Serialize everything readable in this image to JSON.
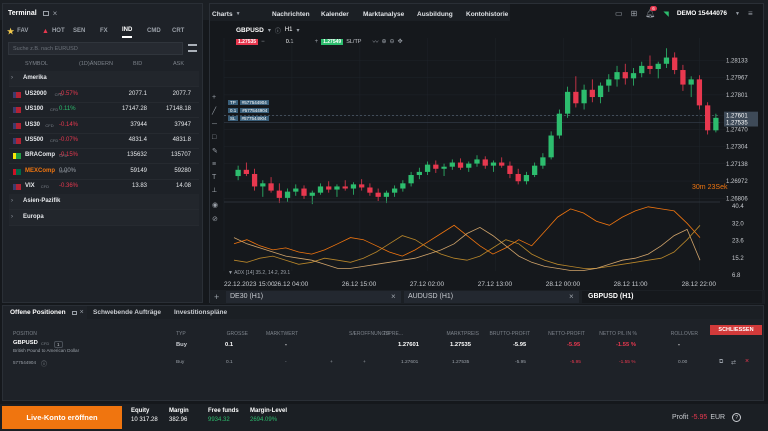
{
  "topbar": {
    "terminal": "Terminal",
    "charts": "Charts",
    "nav": [
      "Nachrichten",
      "Kalender",
      "Marktanalyse",
      "Ausbildung",
      "Kontohistorie"
    ],
    "account": "DEMO 15444076",
    "badge": "6"
  },
  "market": {
    "tabs": [
      "FAV",
      "HOT",
      "SEN",
      "FX",
      "IND",
      "CMD",
      "CRT"
    ],
    "search_placeholder": "Suche z.B. nach EURUSD",
    "columns": [
      "SYMBOL",
      "(1D)ÄNDERN",
      "BID",
      "ASK"
    ],
    "group_america": "Amerika",
    "rows": [
      {
        "symbol": "US2000",
        "tag": "CFD",
        "change": "-0.57%",
        "bid": "2077.1",
        "ask": "2077.7",
        "dir": "down",
        "flag": "us"
      },
      {
        "symbol": "US100",
        "tag": "CFD",
        "change": "0.11%",
        "bid": "17147.28",
        "ask": "17148.18",
        "dir": "up",
        "flag": "us"
      },
      {
        "symbol": "US30",
        "tag": "CFD",
        "change": "-0.14%",
        "bid": "37944",
        "ask": "37947",
        "dir": "down",
        "flag": "us"
      },
      {
        "symbol": "US500",
        "tag": "CFD",
        "change": "-0.07%",
        "bid": "4831.4",
        "ask": "4831.8",
        "dir": "down",
        "flag": "us"
      },
      {
        "symbol": "BRAComp",
        "tag": "CFD",
        "change": "-0.15%",
        "bid": "135632",
        "ask": "135707",
        "dir": "down",
        "flag": "br"
      },
      {
        "symbol": "MEXComp",
        "tag": "CFD",
        "change": "0.00%",
        "bid": "59149",
        "ask": "59280",
        "dir": "flat",
        "flag": "mx"
      },
      {
        "symbol": "VIX",
        "tag": "CFD",
        "change": "-0.36%",
        "bid": "13.83",
        "ask": "14.08",
        "dir": "down",
        "flag": "us"
      }
    ],
    "group_asia": "Asien-Pazifik",
    "group_europe": "Europa"
  },
  "chart": {
    "symbol": "GBPUSD",
    "timeframe": "H1",
    "qty": "0.1",
    "sell": "1.27535",
    "buy": "1.27549",
    "sltp": "SL/TP",
    "prices": [
      "1.28133",
      "1.27967",
      "1.27801",
      "1.27601",
      "1.27535",
      "1.27470",
      "1.27304",
      "1.27138",
      "1.26972",
      "1.26806"
    ],
    "price_highlight": [
      "1.27601",
      "1.27535"
    ],
    "tp_label": "TP",
    "tp_id": "#577544904",
    "pos_qty": "0.1",
    "pos_id": "#577544904",
    "sl_label": "SL",
    "sl_id": "#577544904",
    "timer_min": "30m",
    "timer_sec": "23Sek",
    "osc_levels": [
      "40.4",
      "32.0",
      "23.6",
      "15.2",
      "6.8"
    ],
    "indicator_label": "ADX [14] 35.2, 14.2, 29.1",
    "dates": [
      "22.12.2023 15:00",
      "26.12 04:00",
      "26.12 15:00",
      "27.12 02:00",
      "27.12 13:00",
      "28.12 00:00",
      "28.12 11:00",
      "28.12 22:00"
    ],
    "tabs": [
      "DE30 (H1)",
      "AUDUSD (H1)",
      "GBPUSD (H1)"
    ],
    "candles": [
      [
        1.2702,
        1.2712,
        1.2698,
        1.2708
      ],
      [
        1.2708,
        1.2715,
        1.2702,
        1.2704
      ],
      [
        1.2704,
        1.2709,
        1.2688,
        1.2692
      ],
      [
        1.2692,
        1.2698,
        1.2682,
        1.2695
      ],
      [
        1.2695,
        1.2701,
        1.2686,
        1.2688
      ],
      [
        1.2688,
        1.2695,
        1.2676,
        1.2681
      ],
      [
        1.2681,
        1.269,
        1.2677,
        1.2687
      ],
      [
        1.2687,
        1.2694,
        1.2683,
        1.269
      ],
      [
        1.269,
        1.2693,
        1.268,
        1.2683
      ],
      [
        1.2683,
        1.2688,
        1.2675,
        1.2686
      ],
      [
        1.2686,
        1.2695,
        1.2684,
        1.2692
      ],
      [
        1.2692,
        1.2697,
        1.2686,
        1.2689
      ],
      [
        1.2689,
        1.2694,
        1.2682,
        1.2692
      ],
      [
        1.2692,
        1.2698,
        1.2688,
        1.269
      ],
      [
        1.269,
        1.2696,
        1.2684,
        1.2694
      ],
      [
        1.2694,
        1.2699,
        1.2688,
        1.2691
      ],
      [
        1.2691,
        1.2695,
        1.2683,
        1.2686
      ],
      [
        1.2686,
        1.269,
        1.2678,
        1.2682
      ],
      [
        1.2682,
        1.2688,
        1.2676,
        1.2686
      ],
      [
        1.2686,
        1.2693,
        1.2682,
        1.269
      ],
      [
        1.269,
        1.2698,
        1.2687,
        1.2695
      ],
      [
        1.2695,
        1.2706,
        1.2692,
        1.2703
      ],
      [
        1.2703,
        1.271,
        1.2699,
        1.2706
      ],
      [
        1.2706,
        1.2716,
        1.2703,
        1.2713
      ],
      [
        1.2713,
        1.2717,
        1.2705,
        1.2709
      ],
      [
        1.2709,
        1.2714,
        1.2702,
        1.2711
      ],
      [
        1.2711,
        1.2718,
        1.2708,
        1.2715
      ],
      [
        1.2715,
        1.2719,
        1.2708,
        1.271
      ],
      [
        1.271,
        1.2716,
        1.2706,
        1.2714
      ],
      [
        1.2714,
        1.2722,
        1.2711,
        1.2718
      ],
      [
        1.2718,
        1.2721,
        1.2709,
        1.2712
      ],
      [
        1.2712,
        1.2717,
        1.2706,
        1.2715
      ],
      [
        1.2715,
        1.272,
        1.271,
        1.2712
      ],
      [
        1.2712,
        1.2716,
        1.27,
        1.2704
      ],
      [
        1.2704,
        1.2709,
        1.2694,
        1.2697
      ],
      [
        1.2697,
        1.2706,
        1.2694,
        1.2703
      ],
      [
        1.2703,
        1.2715,
        1.2701,
        1.2712
      ],
      [
        1.2712,
        1.2724,
        1.2709,
        1.272
      ],
      [
        1.272,
        1.2745,
        1.2718,
        1.2741
      ],
      [
        1.2741,
        1.2766,
        1.2738,
        1.2762
      ],
      [
        1.2762,
        1.2788,
        1.2758,
        1.2783
      ],
      [
        1.2783,
        1.2798,
        1.2768,
        1.2772
      ],
      [
        1.2772,
        1.279,
        1.2766,
        1.2785
      ],
      [
        1.2785,
        1.2795,
        1.2773,
        1.2778
      ],
      [
        1.2778,
        1.2792,
        1.2772,
        1.2789
      ],
      [
        1.2789,
        1.28,
        1.2783,
        1.2795
      ],
      [
        1.2795,
        1.2808,
        1.2788,
        1.2802
      ],
      [
        1.2802,
        1.281,
        1.279,
        1.2796
      ],
      [
        1.2796,
        1.2806,
        1.2789,
        1.2801
      ],
      [
        1.2801,
        1.2812,
        1.2797,
        1.2808
      ],
      [
        1.2808,
        1.2818,
        1.28,
        1.2805
      ],
      [
        1.2805,
        1.2812,
        1.2796,
        1.281
      ],
      [
        1.281,
        1.2825,
        1.2806,
        1.2816
      ],
      [
        1.2816,
        1.2821,
        1.28,
        1.2804
      ],
      [
        1.2804,
        1.2809,
        1.2784,
        1.279
      ],
      [
        1.279,
        1.2798,
        1.2778,
        1.2795
      ],
      [
        1.2795,
        1.2799,
        1.2766,
        1.277
      ],
      [
        1.277,
        1.2773,
        1.2742,
        1.2746
      ],
      [
        1.2746,
        1.2762,
        1.2744,
        1.2758
      ]
    ]
  },
  "positions": {
    "tabs": [
      "Offene Positionen",
      "Schwebende Aufträge",
      "Investitionspläne"
    ],
    "columns": [
      "POSITION",
      "TYP",
      "GRÖSSE",
      "MARKTWERT",
      "S/L",
      "T/P",
      "ERÖFFNUNGSPRE...",
      "MARKTPREIS",
      "BRUTTO-PROFIT",
      "NETTO-PROFIT",
      "NETTO P/L IN %",
      "ROLLOVER"
    ],
    "close_button": "SCHLIESSEN",
    "main": {
      "symbol": "GBPUSD",
      "tag": "CFD",
      "count": "1",
      "desc": "British Pound to American Dollar",
      "type": "Buy",
      "size": "0.1",
      "market_value": "-",
      "open": "1.27601",
      "market": "1.27535",
      "gross": "-5.95",
      "net": "-5.95",
      "pct": "-1.55 %",
      "rollover": "-"
    },
    "sub": {
      "id": "577544904",
      "type": "Buy",
      "size": "0.1",
      "market_value": "-",
      "sl": "+",
      "tp": "+",
      "open": "1.27601",
      "market": "1.27535",
      "gross": "-5.95",
      "net": "-5.95",
      "pct": "-1.55 %",
      "rollover": "0.00"
    }
  },
  "footer": {
    "live_button": "Live-Konto eröffnen",
    "equity_label": "Equity",
    "equity": "10 317.28",
    "margin_label": "Margin",
    "margin": "382.96",
    "free_label": "Free funds",
    "free": "9934.32",
    "level_label": "Margin-Level",
    "level": "2694.09%",
    "profit_label": "Profit",
    "profit": "-5.95",
    "currency": "EUR"
  },
  "colors": {
    "up": "#2dbd6e",
    "down": "#e8384f",
    "orange": "#f0750f",
    "bg": "#15181c"
  }
}
